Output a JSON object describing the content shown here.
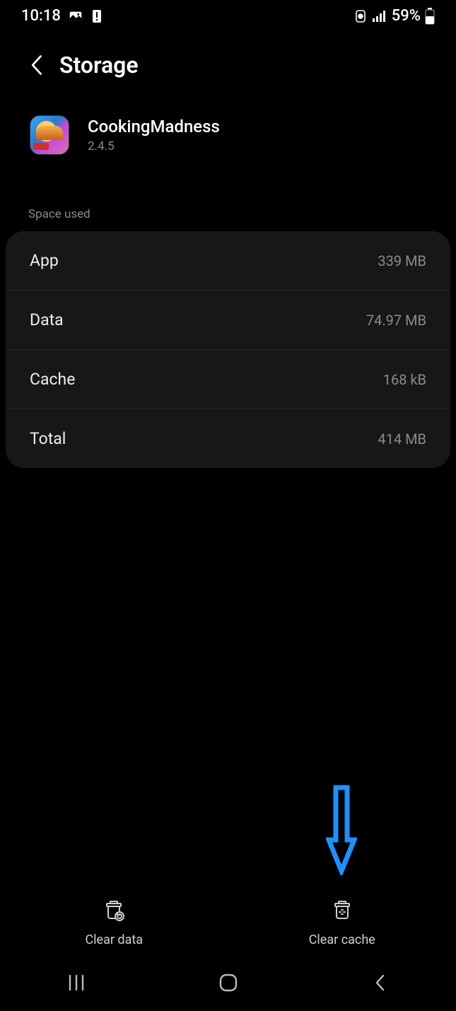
{
  "statusbar": {
    "time": "10:18",
    "battery_text": "59%"
  },
  "header": {
    "title": "Storage"
  },
  "app": {
    "name": "CookingMadness",
    "version": "2.4.5"
  },
  "section": {
    "label": "Space used"
  },
  "rows": {
    "app": {
      "label": "App",
      "value": "339 MB"
    },
    "data": {
      "label": "Data",
      "value": "74.97 MB"
    },
    "cache": {
      "label": "Cache",
      "value": "168 kB"
    },
    "total": {
      "label": "Total",
      "value": "414 MB"
    }
  },
  "actions": {
    "clear_data": "Clear data",
    "clear_cache": "Clear cache"
  }
}
